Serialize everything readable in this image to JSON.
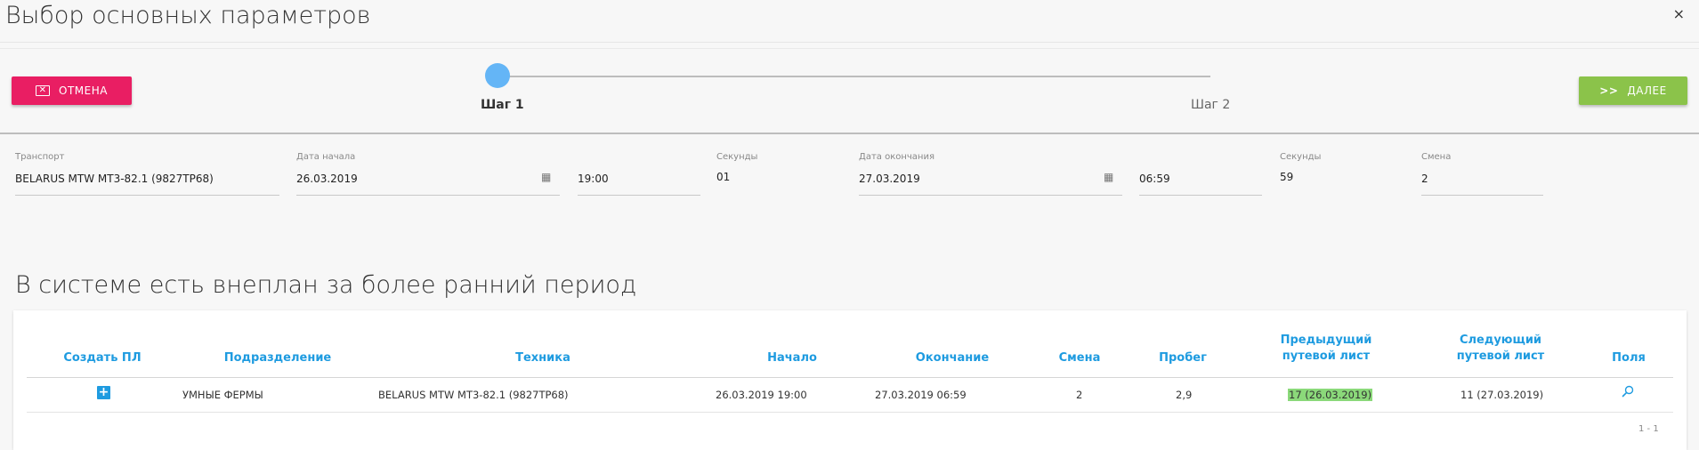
{
  "dialog": {
    "title": "Выбор основных параметров",
    "close_icon": "×"
  },
  "toolbar": {
    "cancel_label": "ОТМЕНА",
    "next_label": "ДАЛЕЕ",
    "next_icon": ">>",
    "cancel_icon": "✕"
  },
  "stepper": {
    "step1": "Шаг 1",
    "step2": "Шаг 2",
    "active_step": 1
  },
  "form": {
    "transport_label": "Транспорт",
    "transport_value": "BELARUS MTW MT3-82.1 (9827ТР68)",
    "start_date_label": "Дата начала",
    "start_date_value": "26.03.2019",
    "start_time_value": "19:00",
    "seconds1_label": "Секунды",
    "seconds1_value": "01",
    "end_date_label": "Дата окончания",
    "end_date_value": "27.03.2019",
    "end_time_value": "06:59",
    "seconds2_label": "Секунды",
    "seconds2_value": "59",
    "shift_label": "Смена",
    "shift_value": "2",
    "calendar_icon": "▦"
  },
  "section": {
    "title": "В системе есть внеплан за более ранний период"
  },
  "table": {
    "headers": {
      "create": "Создать ПЛ",
      "division": "Подразделение",
      "equipment": "Техника",
      "start": "Начало",
      "end": "Окончание",
      "shift": "Смена",
      "mileage": "Пробег",
      "prev_1": "Предыдущий",
      "prev_2": "путевой лист",
      "next_1": "Следующий",
      "next_2": "путевой лист",
      "fields": "Поля"
    },
    "rows": [
      {
        "create_icon": "+",
        "division": "УМНЫЕ ФЕРМЫ",
        "equipment": "BELARUS MTW MT3-82.1 (9827ТР68)",
        "start": "26.03.2019 19:00",
        "end": "27.03.2019 06:59",
        "shift": "2",
        "mileage": "2,9",
        "prev": "17 (26.03.2019)",
        "next": "11 (27.03.2019)",
        "fields_icon": "⚲"
      }
    ],
    "pager": "1 - 1"
  },
  "colors": {
    "accent": "#1e9be0",
    "cancel": "#e91e63",
    "next": "#8bc34a",
    "highlight": "#8bd97a",
    "step_dot": "#64b5f6"
  }
}
